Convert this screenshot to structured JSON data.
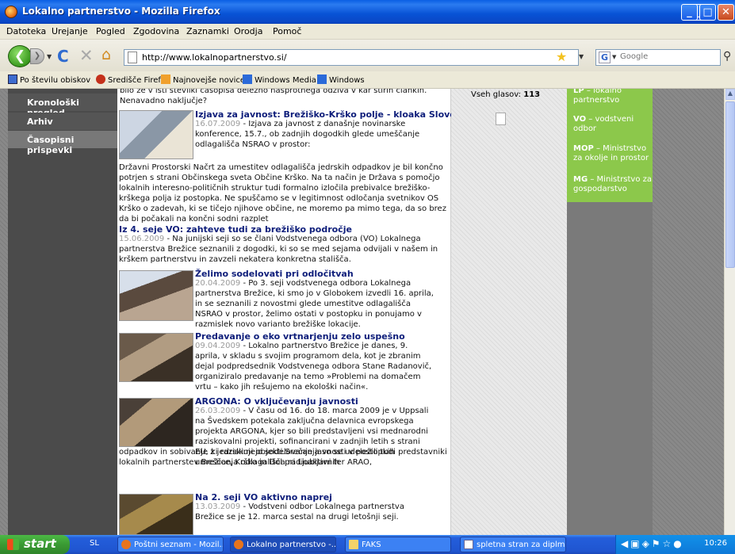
{
  "window": {
    "title": "Lokalno partnerstvo - Mozilla Firefox",
    "minimize_label": "_",
    "maximize_label": "□",
    "close_label": "✕"
  },
  "menu": [
    "Datoteka",
    "Urejanje",
    "Pogled",
    "Zgodovina",
    "Zaznamki",
    "Orodja",
    "Pomoč"
  ],
  "toolbar": {
    "back_label": "❮",
    "fwd_label": "❯",
    "reload_label": "C",
    "stop_label": "✕",
    "home_label": "⌂",
    "url": "http://www.lokalnopartnerstvo.si/",
    "search_engine_label": "G",
    "search_placeholder": "Google"
  },
  "bookmarks": [
    {
      "label": "Po številu obiskov",
      "icon": "blue-page-icon"
    },
    {
      "label": "Središče Firefox",
      "icon": "firefox-icon"
    },
    {
      "label": "Najnovejše novice",
      "icon": "rss-icon"
    },
    {
      "label": "Windows Media",
      "icon": "windows-media-icon"
    },
    {
      "label": "Windows",
      "icon": "windows-icon"
    }
  ],
  "sidebar": {
    "items": [
      {
        "label": "Kronološki pregled"
      },
      {
        "label": "Arhiv"
      },
      {
        "label": "Časopisni prispevki"
      }
    ]
  },
  "articles": {
    "intro": "bilo že v isti številki časopisa deležno nasprotnega odziva v kar štirih člankih. Nenavadno naključje?",
    "items": [
      {
        "title": "Izjava za javnost: Brežiško-Krško polje - kloaka Slovenije?",
        "date": "16.07.2009",
        "summary": " - Izjava za javnost z današnje novinarske konference, 15.7., ob zadnjih dogodkih glede umeščanje odlagališča NSRAO v prostor:",
        "extra": "Državni Prostorski Načrt za umestitev odlagališča jedrskih odpadkov je bil končno potrjen s strani Občinskega sveta Občine Krško. Na ta način je Država s pomočjo lokalnih interesno-političnih struktur tudi formalno izločila prebivalce brežiško-krškega polja iz postopka. Ne spuščamo se v legitimnost odločanja svetnikov OS Krško o zadevah, ki se tičejo njihove občine, ne moremo pa mimo tega, da so brez da bi počakali na končni sodni razplet"
      },
      {
        "title": "Iz 4. seje VO: zahteve tudi za brežiško področje",
        "date": "15.06.2009",
        "summary": " - Na junijski seji so se člani Vodstvenega odbora (VO) Lokalnega partnerstva Brežice seznanili z dogodki, ki so se med sejama odvijali v našem in krškem partnerstvu in zavzeli nekatera konkretna stališča."
      },
      {
        "title": "Želimo sodelovati pri odločitvah",
        "date": "20.04.2009",
        "summary": " - Po 3. seji vodstvenega odbora Lokalnega partnerstva Brežice, ki smo jo v Globokem izvedli 16. aprila, in se seznanili z novostmi glede umestitve odlagališča NSRAO v prostor, želimo ostati v postopku in ponujamo v razmislek novo varianto brežiške lokacije."
      },
      {
        "title": "Predavanje o eko vrtnarjenju zelo uspešno",
        "date": "09.04.2009",
        "summary": " - Lokalno partnerstvo Brežice je danes, 9. aprila, v skladu s svojim programom dela, kot je zbranim dejal podpredsednik Vodstvenega odbora Stane Radanovič, organiziralo predavanje na temo »Problemi na domačem vrtu – kako jih rešujemo na ekološki način«."
      },
      {
        "title": "ARGONA: O vključevanju javnosti",
        "date": "26.03.2009",
        "summary": " - V času od 16. do 18. marca 2009 je v Uppsali na Švedskem potekala zaključna delavnica evropskega projekta ARGONA, kjer so bili predstavljeni vsi mednarodni raziskovalni projekti, sofinancirani v zadnjih letih s strani EU, ki raziskujejo sodelovanje javnosti v postopkih umeščanja odlagališča radioaktivnih",
        "extra": "odpadkov in sobivanje z jedrskimi objekti.Srečanja so se udeležili tudi predstavniki lokalnih partnerstev Brežice, Krško in Dol pri Ljubljani ter ARAO,"
      },
      {
        "title": "Na 2. seji VO aktivno naprej",
        "date": "13.03.2009",
        "summary": " - Vodstveni odbor Lokalnega partnerstva Brežice se je 12. marca sestal na drugi letošnji seji."
      }
    ]
  },
  "poll": {
    "votes_label": "Vseh glasov:",
    "votes_value": "113"
  },
  "legend": [
    {
      "abbr": "LP",
      "text": "– lokalno partnerstvo"
    },
    {
      "abbr": "VO",
      "text": "– vodstveni odbor"
    },
    {
      "abbr": "MOP",
      "text": "– Ministrstvo za okolje in prostor"
    },
    {
      "abbr": "MG",
      "text": "– Ministrstvo za gospodarstvo"
    }
  ],
  "taskbar": {
    "start_label": "start",
    "lang": "SL",
    "tasks": [
      {
        "label": "Poštni seznam - Mozil...",
        "icon": "firefox-icon"
      },
      {
        "label": "Lokalno partnerstvo -...",
        "icon": "firefox-icon"
      },
      {
        "label": "FAKS",
        "icon": "folder-icon"
      },
      {
        "label": "spletna stran za diplm...",
        "icon": "document-icon"
      }
    ],
    "clock": "10:26"
  },
  "colors": {
    "titlebar": "#0a5fe4",
    "sidebar_bg": "#4b4b4b",
    "legend_bg": "#8cc84b",
    "article_title": "#0d1d7a",
    "taskbar": "#245edb"
  }
}
